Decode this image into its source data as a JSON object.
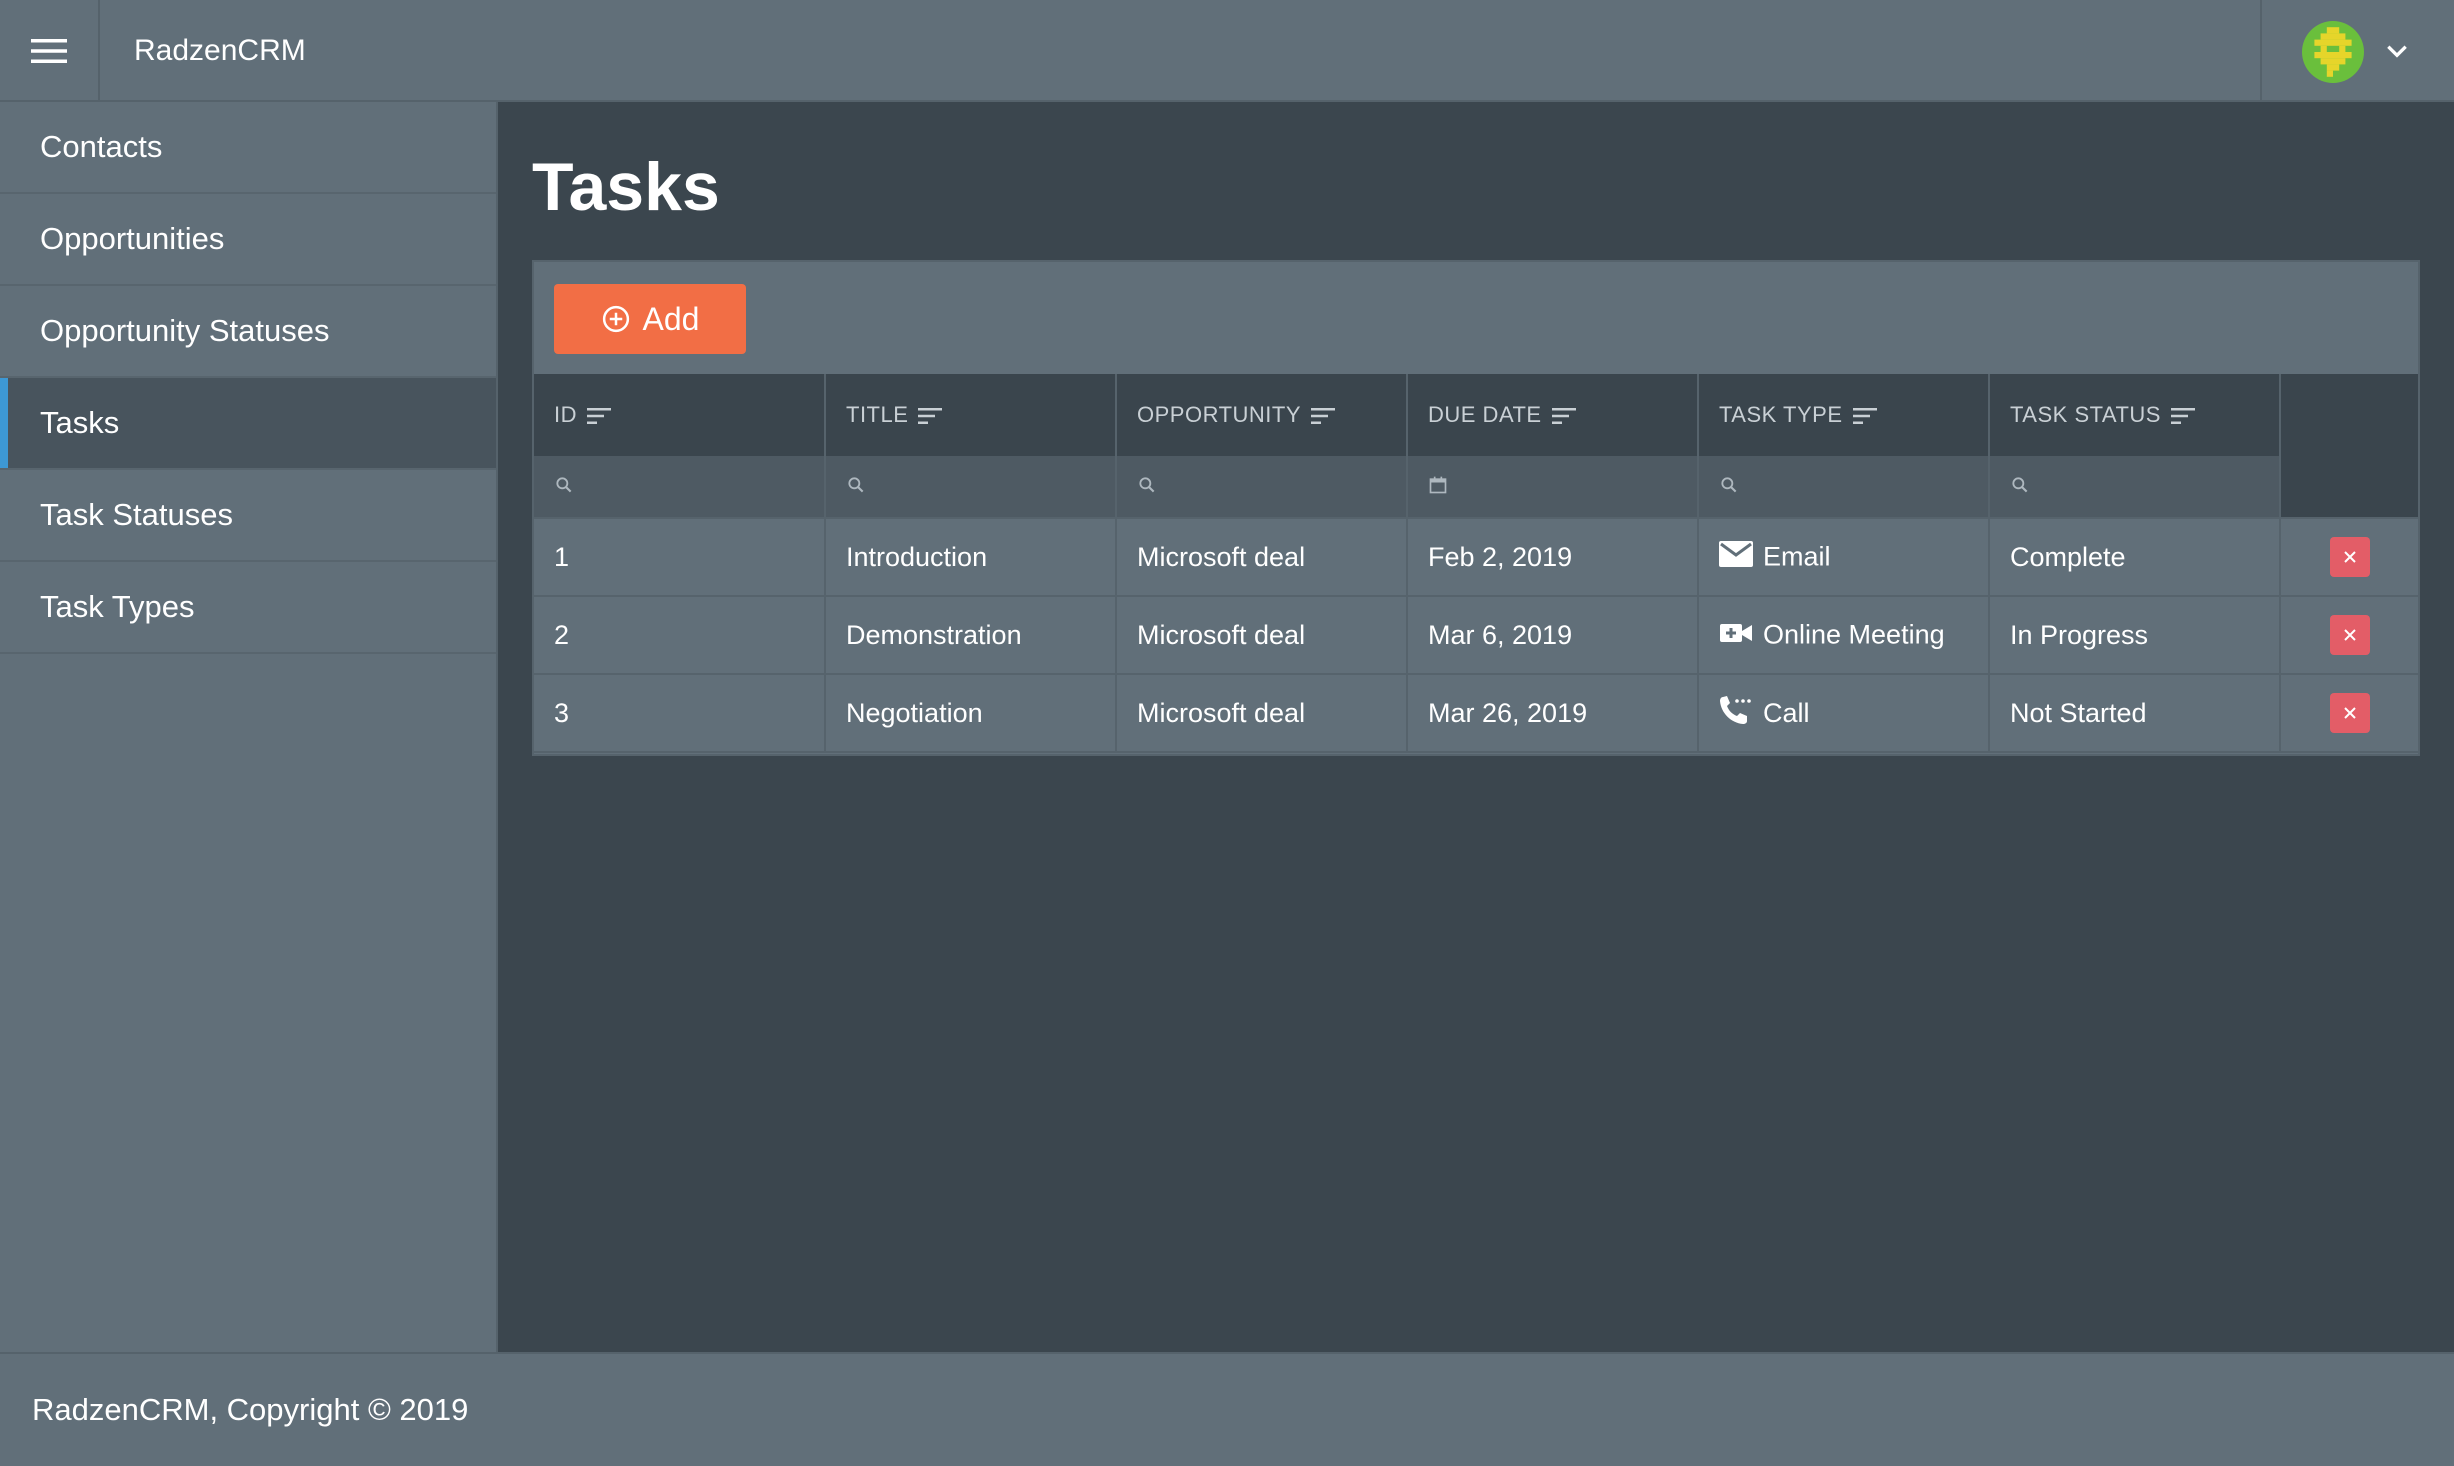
{
  "header": {
    "brand": "RadzenCRM",
    "menu_icon": "hamburger-menu-icon",
    "avatar_icon": "user-avatar-identicon",
    "dropdown_icon": "chevron-down-icon"
  },
  "sidebar": {
    "items": [
      {
        "label": "Contacts",
        "active": false
      },
      {
        "label": "Opportunities",
        "active": false
      },
      {
        "label": "Opportunity Statuses",
        "active": false
      },
      {
        "label": "Tasks",
        "active": true
      },
      {
        "label": "Task Statuses",
        "active": false
      },
      {
        "label": "Task Types",
        "active": false
      }
    ]
  },
  "page": {
    "title": "Tasks",
    "add_label": "Add"
  },
  "grid": {
    "columns": [
      "ID",
      "TITLE",
      "OPPORTUNITY",
      "DUE DATE",
      "TASK TYPE",
      "TASK STATUS"
    ],
    "filter_icons": [
      "search-icon",
      "search-icon",
      "search-icon",
      "calendar-icon",
      "search-icon",
      "search-icon"
    ],
    "rows": [
      {
        "id": "1",
        "title": "Introduction",
        "opportunity": "Microsoft deal",
        "due_date": "Feb 2, 2019",
        "task_type": "Email",
        "task_type_icon": "email-icon",
        "task_status": "Complete"
      },
      {
        "id": "2",
        "title": "Demonstration",
        "opportunity": "Microsoft deal",
        "due_date": "Mar 6, 2019",
        "task_type": "Online Meeting",
        "task_type_icon": "video-call-icon",
        "task_status": "In Progress"
      },
      {
        "id": "3",
        "title": "Negotiation",
        "opportunity": "Microsoft deal",
        "due_date": "Mar 26, 2019",
        "task_type": "Call",
        "task_type_icon": "phone-call-icon",
        "task_status": "Not Started"
      }
    ]
  },
  "footer": {
    "copyright": "RadzenCRM, Copyright © 2019"
  },
  "colors": {
    "header_bg": "#616f79",
    "content_bg": "#3b464e",
    "accent_active": "#3d98d4",
    "add_button": "#f26e45",
    "delete_button": "#e35d67"
  }
}
